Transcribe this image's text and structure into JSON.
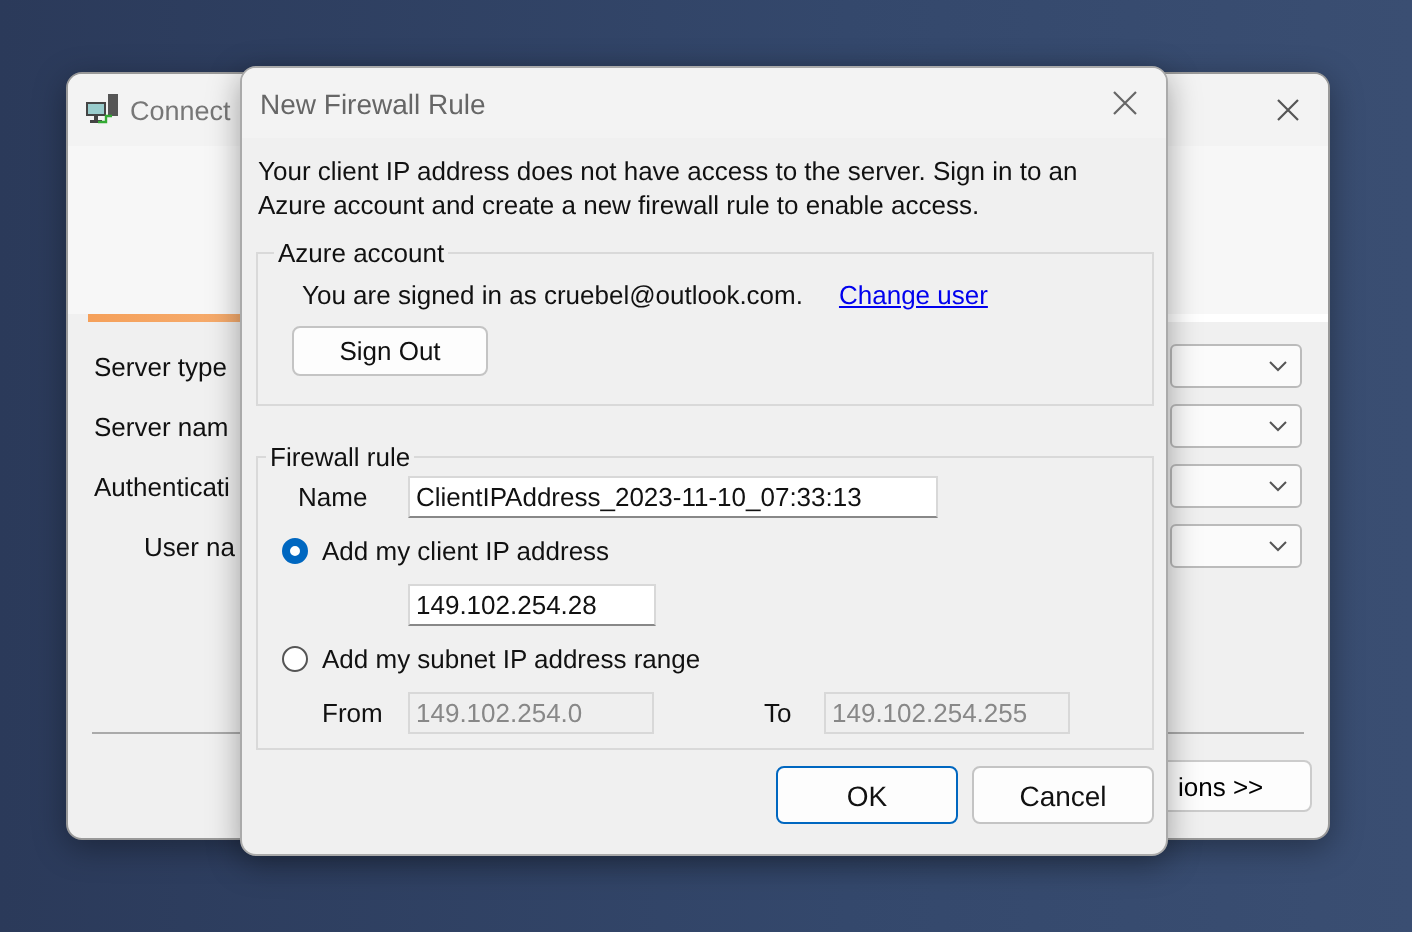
{
  "background_window": {
    "title": "Connect",
    "fields": [
      {
        "label": "Server type",
        "indented": false
      },
      {
        "label": "Server nam",
        "indented": false
      },
      {
        "label": "Authenticati",
        "indented": false
      },
      {
        "label": "User na",
        "indented": true
      }
    ],
    "button": "ions >>"
  },
  "dialog": {
    "title": "New Firewall Rule",
    "message": "Your client IP address does not have access to the server. Sign in to an Azure account and create a new firewall rule to enable access.",
    "azure_account": {
      "legend": "Azure account",
      "signed_in_text": "You are signed in as cruebel@outlook.com.",
      "link": "Change user",
      "button": "Sign Out"
    },
    "firewall_rule": {
      "legend": "Firewall rule",
      "name_label": "Name",
      "name_value": "ClientIPAddress_2023-11-10_07:33:13",
      "options": [
        {
          "label": "Add my client IP address",
          "selected": true
        },
        {
          "label": "Add my subnet IP address range",
          "selected": false
        }
      ],
      "client_ip": "149.102.254.28",
      "from_label": "From",
      "from_value": "149.102.254.0",
      "to_label": "To",
      "to_value": "149.102.254.255",
      "range_disabled": true
    },
    "buttons": [
      {
        "label": "OK",
        "default": true
      },
      {
        "label": "Cancel",
        "default": false
      }
    ]
  }
}
